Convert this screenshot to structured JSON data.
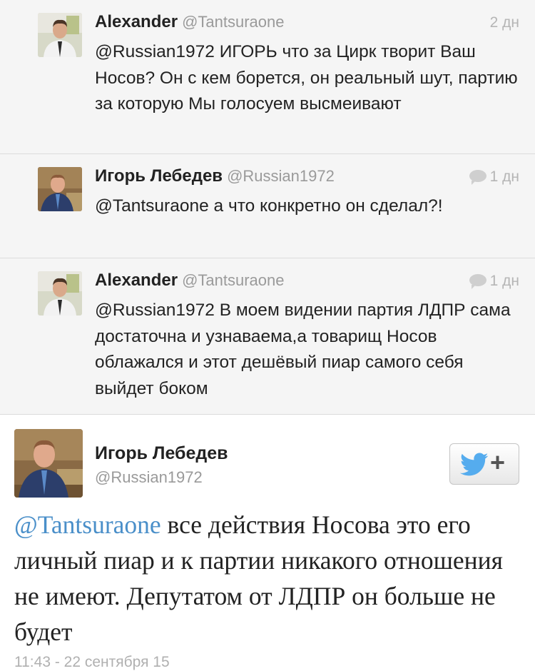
{
  "replies": [
    {
      "name": "Alexander",
      "handle": "@Tantsuraone",
      "time": "2 дн",
      "text": "@Russian1972 ИГОРЬ что за Цирк творит Ваш Носов? Он с кем борется, он реальный шут, партию за которую Мы голосуем высмеивают"
    },
    {
      "name": "Игорь Лебедев",
      "handle": "@Russian1972",
      "time": "1 дн",
      "text": "@Tantsuraone а что конкретно он сделал?!"
    },
    {
      "name": "Alexander",
      "handle": "@Tantsuraone",
      "time": "1 дн",
      "text": "@Russian1972 В моем видении партия ЛДПР сама достаточна и узнаваема,а товарищ Носов облажался и этот дешёвый пиар самого себя выйдет боком"
    }
  ],
  "main_tweet": {
    "name": "Игорь Лебедев",
    "handle": "@Russian1972",
    "mention": "@Tantsuraone",
    "text": " все действия Носова это его личный пиар и к партии никакого отношения не имеют. Депутатом от ЛДПР он больше не будет",
    "timestamp": "11:43 - 22 сентября 15",
    "follow_icon": "twitter-bird-icon",
    "follow_symbol": "+"
  },
  "colors": {
    "thread_bg": "#f5f5f5",
    "link_blue": "#4a8fc9",
    "twitter_blue": "#55acee"
  }
}
